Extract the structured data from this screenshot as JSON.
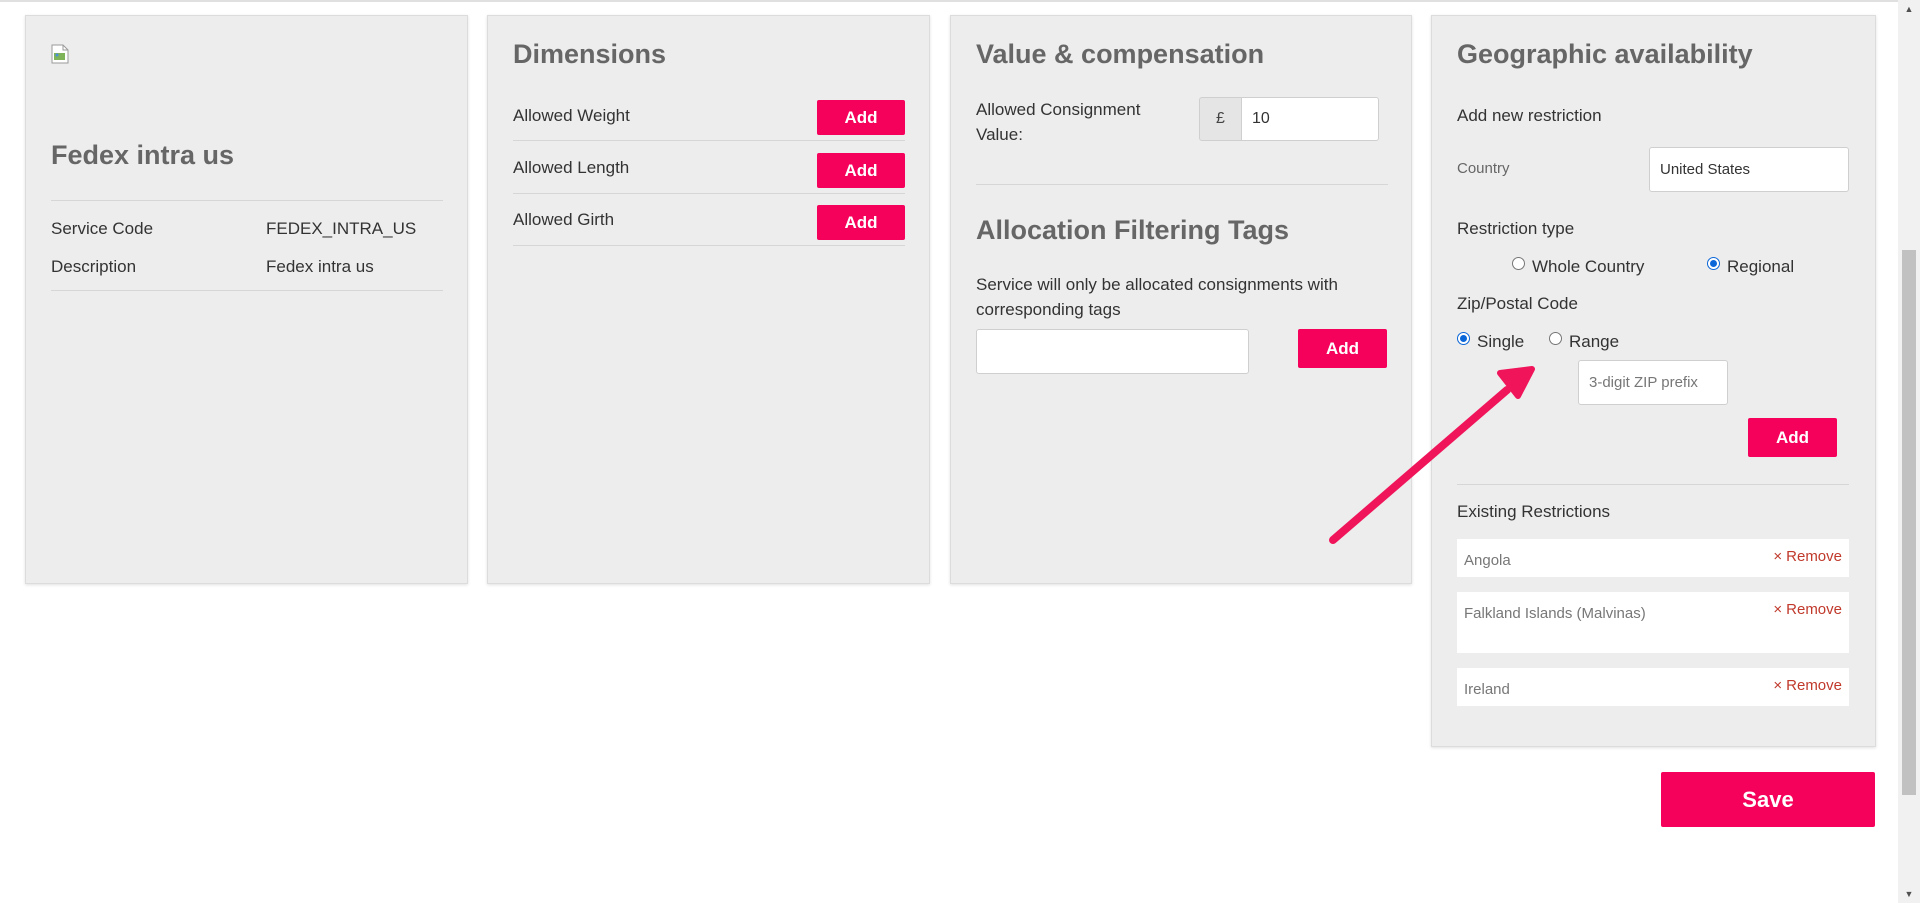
{
  "service": {
    "title": "Fedex intra us",
    "fields": [
      {
        "label": "Service Code",
        "value": "FEDEX_INTRA_US"
      },
      {
        "label": "Description",
        "value": "Fedex intra us"
      }
    ]
  },
  "dimensions": {
    "title": "Dimensions",
    "rows": [
      {
        "label": "Allowed Weight",
        "button": "Add"
      },
      {
        "label": "Allowed Length",
        "button": "Add"
      },
      {
        "label": "Allowed Girth",
        "button": "Add"
      }
    ]
  },
  "value": {
    "title": "Value & compensation",
    "consignment_label_line1": "Allowed Consignment",
    "consignment_label_line2": "Value:",
    "currency_symbol": "£",
    "consignment_value": "10"
  },
  "tags": {
    "title": "Allocation Filtering Tags",
    "description_line1": "Service will only be allocated consignments with",
    "description_line2": "corresponding tags",
    "input_value": "",
    "add_label": "Add"
  },
  "geo": {
    "title": "Geographic availability",
    "add_new_label": "Add new restriction",
    "country_label": "Country",
    "country_value": "United States",
    "restriction_type_label": "Restriction type",
    "restriction_types": [
      {
        "label": "Whole Country",
        "checked": false
      },
      {
        "label": "Regional",
        "checked": true
      }
    ],
    "zip_label": "Zip/Postal Code",
    "zip_modes": [
      {
        "label": "Single",
        "checked": true
      },
      {
        "label": "Range",
        "checked": false
      }
    ],
    "zip_placeholder": "3-digit ZIP prefix",
    "add_label": "Add",
    "existing_label": "Existing Restrictions",
    "existing": [
      {
        "name": "Angola",
        "remove": "Remove"
      },
      {
        "name": "Falkland Islands (Malvinas)",
        "remove": "Remove"
      },
      {
        "name": "Ireland",
        "remove": "Remove"
      }
    ],
    "remove_icon": "×"
  },
  "save_label": "Save",
  "colors": {
    "accent": "#f5005a",
    "card_bg": "#ededed",
    "radio_checked": "#0b67d8",
    "remove": "#c0392b"
  },
  "annotation": {
    "type": "arrow",
    "color": "#f0145a"
  }
}
